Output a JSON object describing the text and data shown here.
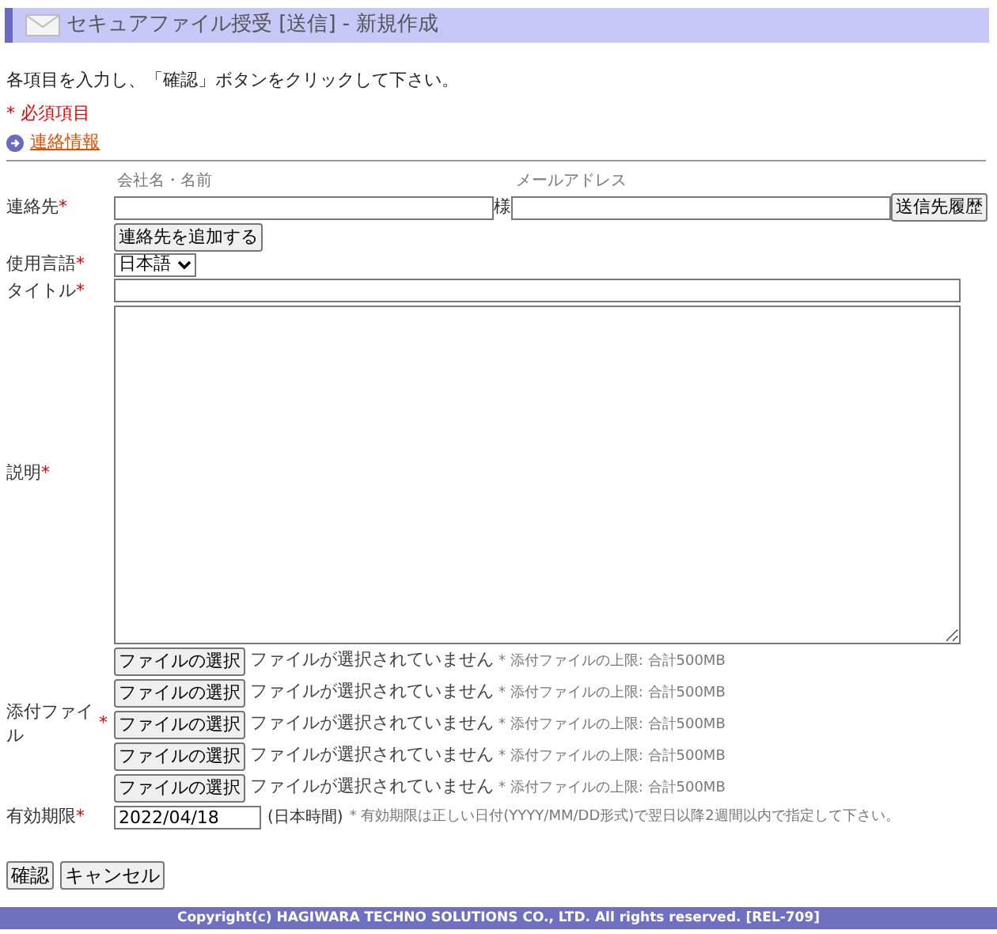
{
  "header": {
    "title": "セキュアファイル授受 [送信] - 新規作成"
  },
  "instruction": "各項目を入力し、「確認」ボタンをクリックして下さい。",
  "required_note": "* 必須項目",
  "section_link": "連絡情報",
  "contact": {
    "label": "連絡先",
    "required_mark": "*",
    "name_heading": "会社名・名前",
    "email_heading": "メールアドレス",
    "honorific": "様",
    "history_button": "送信先履歴",
    "add_button": "連絡先を追加する"
  },
  "language": {
    "label": "使用言語",
    "required_mark": "*",
    "value": "日本語"
  },
  "title_field": {
    "label": "タイトル",
    "required_mark": "*"
  },
  "description": {
    "label": "説明",
    "required_mark": "*"
  },
  "attachments": {
    "label": "添付ファイル",
    "required_mark": "*",
    "files": [
      {
        "button": "ファイルの選択",
        "status": "ファイルが選択されていません",
        "note": "* 添付ファイルの上限: 合計500MB"
      },
      {
        "button": "ファイルの選択",
        "status": "ファイルが選択されていません",
        "note": "* 添付ファイルの上限: 合計500MB"
      },
      {
        "button": "ファイルの選択",
        "status": "ファイルが選択されていません",
        "note": "* 添付ファイルの上限: 合計500MB"
      },
      {
        "button": "ファイルの選択",
        "status": "ファイルが選択されていません",
        "note": "* 添付ファイルの上限: 合計500MB"
      },
      {
        "button": "ファイルの選択",
        "status": "ファイルが選択されていません",
        "note": "* 添付ファイルの上限: 合計500MB"
      }
    ]
  },
  "expiry": {
    "label": "有効期限",
    "required_mark": "*",
    "value": "2022/04/18",
    "timezone": "(日本時間)",
    "note": "* 有効期限は正しい日付(YYYY/MM/DD形式)で翌日以降2週間以内で指定して下さい。"
  },
  "buttons": [
    "確認",
    "キャンセル"
  ],
  "footer": "Copyright(c) HAGIWARA TECHNO SOLUTIONS CO., LTD. All rights reserved.  [REL-709]"
}
